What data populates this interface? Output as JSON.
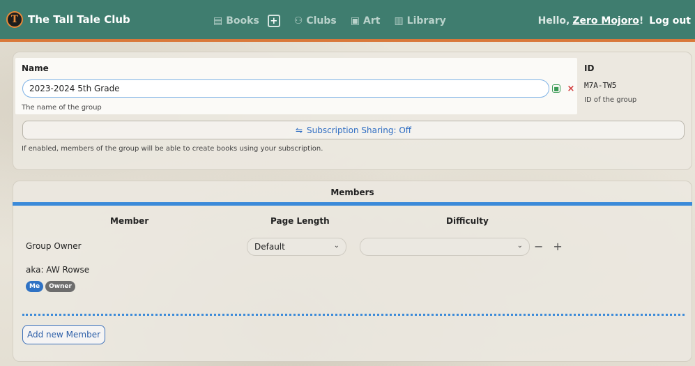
{
  "brand": {
    "name": "The Tall Tale Club",
    "logo": "T"
  },
  "nav": {
    "books": "Books",
    "add": "+",
    "clubs": "Clubs",
    "art": "Art",
    "library": "Library"
  },
  "user": {
    "greeting": "Hello,",
    "name": "Zero Mojoro",
    "bang": "!",
    "logout": "Log out"
  },
  "group": {
    "name_label": "Name",
    "name_value": "2023-2024 5th Grade",
    "name_help": "The name of the group",
    "id_label": "ID",
    "id_value": "M7A-TW5",
    "id_help": "ID of the group",
    "subscription_label": "Subscription Sharing: Off",
    "subscription_help": "If enabled, members of the group will be able to create books using your subscription."
  },
  "members": {
    "title": "Members",
    "columns": {
      "member": "Member",
      "page_length": "Page Length",
      "difficulty": "Difficulty"
    },
    "rows": [
      {
        "name": "Group Owner",
        "aka": "aka: AW Rowse",
        "badges": [
          "Me",
          "Owner"
        ],
        "page_length": "Default",
        "difficulty": ""
      }
    ],
    "add_label": "Add new Member"
  },
  "colors": {
    "nav_bg": "#3f7d6f",
    "nav_accent": "#d9783a",
    "primary": "#3b8ad9",
    "danger": "#d23b3b",
    "success": "#3a9a55"
  }
}
